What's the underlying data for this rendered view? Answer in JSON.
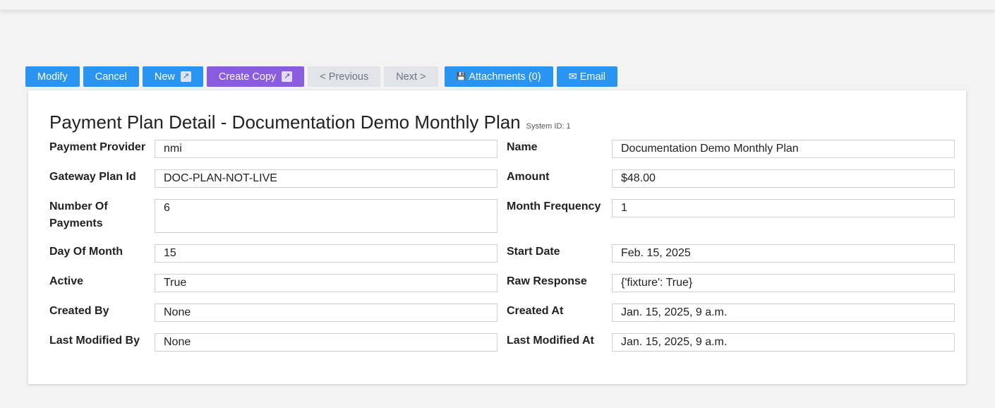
{
  "toolbar": {
    "modify": "Modify",
    "cancel": "Cancel",
    "new": "New",
    "create_copy": "Create Copy",
    "previous": "< Previous",
    "next": "Next >",
    "attachments": "Attachments (0)",
    "email": "Email",
    "external_glyph": "↗",
    "attachments_glyph": "💾",
    "email_glyph": "✉"
  },
  "page": {
    "title": "Payment Plan Detail - Documentation Demo Monthly Plan",
    "system_id": "System ID: 1"
  },
  "fields": {
    "payment_provider": {
      "label": "Payment Provider",
      "value": "nmi"
    },
    "name": {
      "label": "Name",
      "value": "Documentation Demo Monthly Plan"
    },
    "gateway_plan_id": {
      "label": "Gateway Plan Id",
      "value": "DOC-PLAN-NOT-LIVE"
    },
    "amount": {
      "label": "Amount",
      "value": "$48.00"
    },
    "number_of_payments": {
      "label": "Number Of Payments",
      "value": "6"
    },
    "month_frequency": {
      "label": "Month Frequency",
      "value": "1"
    },
    "day_of_month": {
      "label": "Day Of Month",
      "value": "15"
    },
    "start_date": {
      "label": "Start Date",
      "value": "Feb. 15, 2025"
    },
    "active": {
      "label": "Active",
      "value": "True"
    },
    "raw_response": {
      "label": "Raw Response",
      "value": "{'fixture': True}"
    },
    "created_by": {
      "label": "Created By",
      "value": "None"
    },
    "created_at": {
      "label": "Created At",
      "value": "Jan. 15, 2025, 9 a.m."
    },
    "last_modified_by": {
      "label": "Last Modified By",
      "value": "None"
    },
    "last_modified_at": {
      "label": "Last Modified At",
      "value": "Jan. 15, 2025, 9 a.m."
    }
  },
  "colors": {
    "primary_button": "#2a95f0",
    "copy_button": "#8a5ce0",
    "disabled_button": "#e1e5ea",
    "background": "#f3f3f4"
  }
}
